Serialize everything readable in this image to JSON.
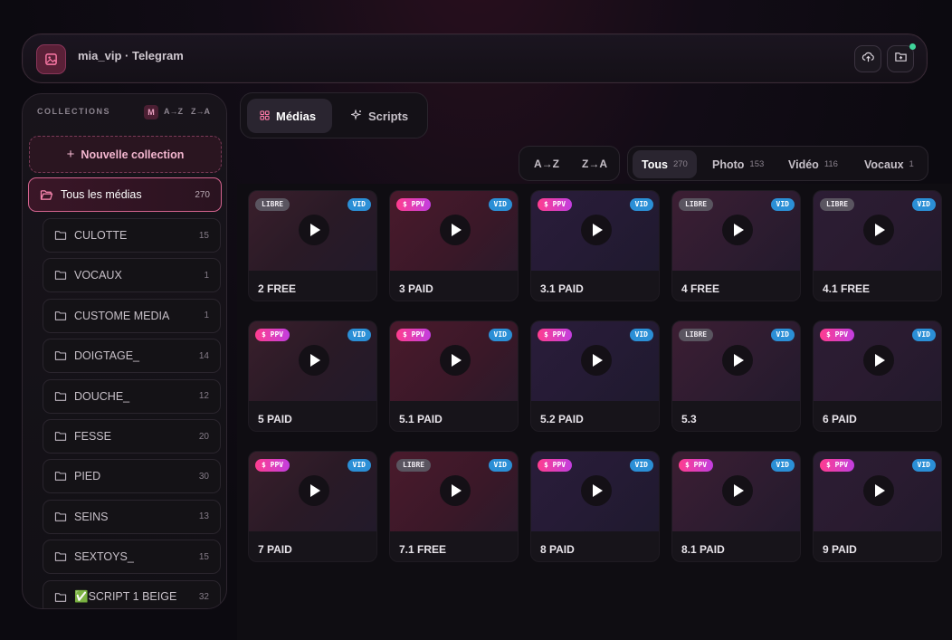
{
  "topbar": {
    "title": "mia_vip · Telegram",
    "icons": [
      "image-icon",
      "cloud-upload-icon",
      "folder-add-icon"
    ]
  },
  "sidebar": {
    "heading": "COLLECTIONS",
    "sort_m": "M",
    "sort_az": "A→Z",
    "sort_za": "Z→A",
    "new_collection": "Nouvelle collection",
    "all_media": {
      "label": "Tous les médias",
      "count": "270"
    },
    "collections": [
      {
        "label": "CULOTTE",
        "count": "15"
      },
      {
        "label": "VOCAUX",
        "count": "1"
      },
      {
        "label": "CUSTOME MEDIA",
        "count": "1"
      },
      {
        "label": "DOIGTAGE_",
        "count": "14"
      },
      {
        "label": "DOUCHE_",
        "count": "12"
      },
      {
        "label": "FESSE",
        "count": "20"
      },
      {
        "label": "PIED",
        "count": "30"
      },
      {
        "label": "SEINS",
        "count": "13"
      },
      {
        "label": "SEXTOYS_",
        "count": "15"
      },
      {
        "label": "✅SCRIPT 1 BEIGE",
        "count": "32"
      }
    ]
  },
  "tabs": {
    "medias": "Médias",
    "scripts": "Scripts"
  },
  "sort": {
    "az": "A→Z",
    "za": "Z→A"
  },
  "filters": [
    {
      "label": "Tous",
      "count": "270"
    },
    {
      "label": "Photo",
      "count": "153"
    },
    {
      "label": "Vidéo",
      "count": "116"
    },
    {
      "label": "Vocaux",
      "count": "1"
    }
  ],
  "media": [
    {
      "title": "2 FREE",
      "tag": "LIBRE",
      "type": "VID"
    },
    {
      "title": "3 PAID",
      "tag": "$ PPV",
      "type": "VID"
    },
    {
      "title": "3.1 PAID",
      "tag": "$ PPV",
      "type": "VID"
    },
    {
      "title": "4 FREE",
      "tag": "LIBRE",
      "type": "VID"
    },
    {
      "title": "4.1 FREE",
      "tag": "LIBRE",
      "type": "VID"
    },
    {
      "title": "5 PAID",
      "tag": "$ PPV",
      "type": "VID"
    },
    {
      "title": "5.1 PAID",
      "tag": "$ PPV",
      "type": "VID"
    },
    {
      "title": "5.2 PAID",
      "tag": "$ PPV",
      "type": "VID"
    },
    {
      "title": "5.3",
      "tag": "LIBRE",
      "type": "VID"
    },
    {
      "title": "6 PAID",
      "tag": "$ PPV",
      "type": "VID"
    },
    {
      "title": "7 PAID",
      "tag": "$ PPV",
      "type": "VID"
    },
    {
      "title": "7.1 FREE",
      "tag": "LIBRE",
      "type": "VID"
    },
    {
      "title": "8 PAID",
      "tag": "$ PPV",
      "type": "VID"
    },
    {
      "title": "8.1 PAID",
      "tag": "$ PPV",
      "type": "VID"
    },
    {
      "title": "9 PAID",
      "tag": "$ PPV",
      "type": "VID"
    }
  ],
  "colors": {
    "accent": "#d4648f",
    "vid_badge": "#2b8fd6",
    "ppv_badge": "#ff3d8f",
    "online_dot": "#3fd49a"
  }
}
